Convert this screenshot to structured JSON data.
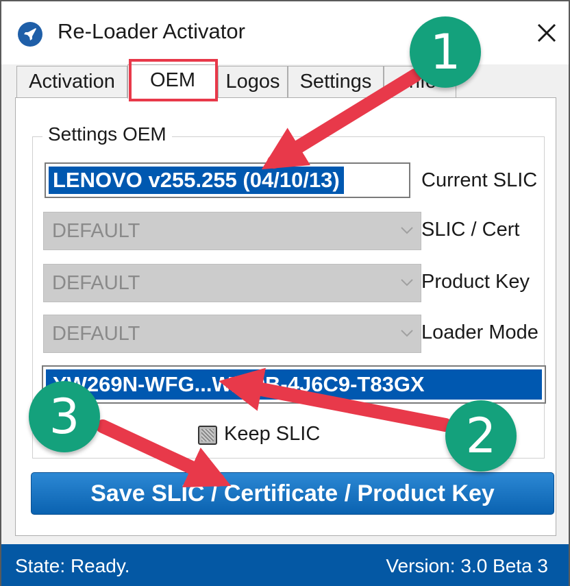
{
  "window": {
    "title": "Re-Loader Activator",
    "icon": "rocket-icon",
    "close_icon": "close-icon"
  },
  "tabs": [
    {
      "label": "Activation"
    },
    {
      "label": "OEM",
      "active": true
    },
    {
      "label": "Logos"
    },
    {
      "label": "Settings"
    },
    {
      "label": "Info"
    }
  ],
  "oem": {
    "group_label": "Settings OEM",
    "current_slic_value": "LENOVO v255.255 (04/10/13)",
    "current_slic_label": "Current SLIC",
    "slic_cert": {
      "value": "DEFAULT",
      "label": "SLIC / Cert"
    },
    "product_key": {
      "value": "DEFAULT",
      "label": "Product Key"
    },
    "loader_mode": {
      "value": "DEFAULT",
      "label": "Loader Mode"
    },
    "key_value": "YW269N-WFG...W/C9B-4J6C9-T83GX",
    "keep_slic_label": "Keep SLIC",
    "save_button_label": "Save SLIC / Certificate / Product Key"
  },
  "status": {
    "state": "State: Ready.",
    "version": "Version: 3.0 Beta 3"
  },
  "annotations": {
    "badges": [
      "1",
      "2",
      "3"
    ],
    "badge_color": "#14a17c",
    "arrow_color": "#e8394a",
    "highlight_color": "#e8394a"
  }
}
